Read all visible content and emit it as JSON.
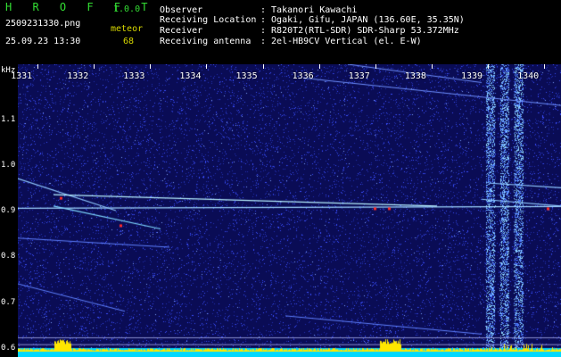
{
  "app": {
    "name": "H R O F F T",
    "version": "1.0.0",
    "filename": "2509231330.png",
    "datetime": "25.09.23 13:30",
    "mode_label": "meteor",
    "count": "68"
  },
  "info": {
    "observer_label": "Observer",
    "observer_value": ": Takanori Kawachi",
    "location_label": "Receiving Location",
    "location_value": ": Ogaki, Gifu, JAPAN (136.60E, 35.35N)",
    "receiver_label": "Receiver",
    "receiver_value": ": R820T2(RTL-SDR) SDR-Sharp 53.372MHz",
    "antenna_label": "Receiving antenna",
    "antenna_value": ": 2el-HB9CV Vertical (el. E-W)"
  },
  "chart_data": {
    "type": "heatmap",
    "ylabel": "kHz",
    "yticks": [
      "1.1",
      "1.0",
      "0.9",
      "0.8",
      "0.7",
      "0.6"
    ],
    "xticks": [
      "1331",
      "1332",
      "1333",
      "1334",
      "1335",
      "1336",
      "1337",
      "1338",
      "1339",
      "1340"
    ],
    "ylim": [
      0.58,
      1.22
    ],
    "xlim": [
      1330.65,
      1340.3
    ],
    "carrier_khz": 0.905,
    "interference_minutes": [
      1339.05,
      1339.3,
      1339.55
    ],
    "colors": {
      "background": "#0a0c55",
      "noise": "#3a4fff",
      "trace": "#9fd6ff",
      "hot": "#ff2a2a",
      "bottom_bar": "#00d8ff",
      "bottom_peaks": "#ffe600"
    }
  }
}
